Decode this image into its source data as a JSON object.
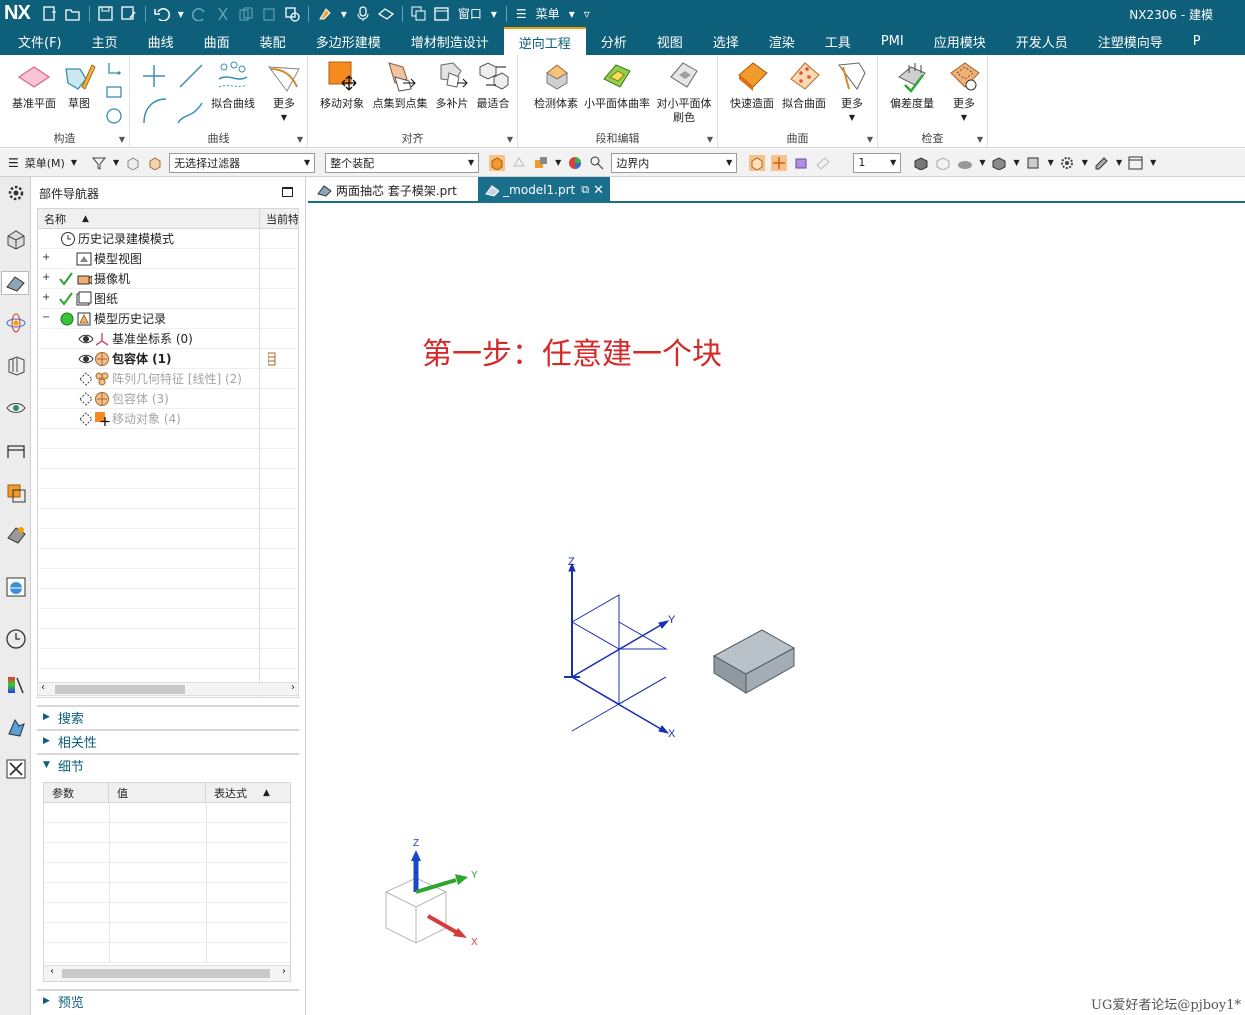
{
  "app": {
    "logo": "NX",
    "title": "NX2306 - 建模",
    "window_menu": "窗口",
    "menu_label": "菜单"
  },
  "tabs": [
    "文件(F)",
    "主页",
    "曲线",
    "曲面",
    "装配",
    "多边形建模",
    "增材制造设计",
    "逆向工程",
    "分析",
    "视图",
    "选择",
    "渲染",
    "工具",
    "PMI",
    "应用模块",
    "开发人员",
    "注塑模向导",
    "P"
  ],
  "active_tab": "逆向工程",
  "ribbon": {
    "groups": [
      {
        "label": "构造",
        "buttons": [
          "基准平面",
          "草图"
        ]
      },
      {
        "label": "曲线",
        "buttons": [
          "拟合曲线",
          "更多"
        ]
      },
      {
        "label": "对齐",
        "buttons": [
          "移动对象",
          "点集到点集",
          "多补片",
          "最适合"
        ]
      },
      {
        "label": "段和编辑",
        "buttons": [
          "检测体素",
          "小平面体曲率",
          "对小平面体刷色"
        ]
      },
      {
        "label": "曲面",
        "buttons": [
          "快速造面",
          "拟合曲面",
          "更多"
        ]
      },
      {
        "label": "检查",
        "buttons": [
          "偏差度量",
          "更多"
        ]
      }
    ]
  },
  "selection_bar": {
    "menu": "菜单(M)",
    "filter": "无选择过滤器",
    "assembly": "整个装配",
    "scope": "边界内",
    "layer": "1"
  },
  "navigator": {
    "title": "部件导航器",
    "col_name": "名称",
    "col_current": "当前特",
    "rows": [
      {
        "label": "历史记录建模模式",
        "icon": "clock-icon",
        "expand": "",
        "state": "normal"
      },
      {
        "label": "模型视图",
        "icon": "model-view-icon",
        "expand": "+",
        "state": "normal"
      },
      {
        "label": "摄像机",
        "icon": "camera-icon",
        "expand": "+",
        "state": "normal"
      },
      {
        "label": "图纸",
        "icon": "drawing-icon",
        "expand": "+",
        "state": "normal"
      },
      {
        "label": "模型历史记录",
        "icon": "history-icon",
        "expand": "−",
        "state": "normal"
      },
      {
        "label": "基准坐标系 (0)",
        "icon": "datum-csys-icon",
        "expand": "",
        "state": "normal"
      },
      {
        "label": "包容体 (1)",
        "icon": "bounding-body-icon",
        "expand": "",
        "state": "bold"
      },
      {
        "label": "阵列几何特征 [线性] (2)",
        "icon": "pattern-icon",
        "expand": "",
        "state": "dim"
      },
      {
        "label": "包容体 (3)",
        "icon": "bounding-body-icon",
        "expand": "",
        "state": "dim"
      },
      {
        "label": "移动对象 (4)",
        "icon": "move-object-icon",
        "expand": "",
        "state": "dim"
      }
    ],
    "sections": {
      "search": "搜索",
      "dependencies": "相关性",
      "details": "细节",
      "preview": "预览"
    },
    "detail_columns": [
      "参数",
      "值",
      "表达式"
    ]
  },
  "documents": [
    {
      "name": "两面抽芯 套子模架.prt",
      "active": false
    },
    {
      "name": "_model1.prt",
      "active": true
    }
  ],
  "viewport": {
    "annotation": "第一步：任意建一个块",
    "axis_labels": {
      "x": "X",
      "y": "Y",
      "z": "Z"
    },
    "watermark": "UG爱好者论坛@pjboy1*"
  },
  "colors": {
    "brand": "#0d5f7a",
    "active_tab_accent": "#f0a000",
    "annotation": "#d42a2a",
    "csys": "#1a2fb0"
  }
}
